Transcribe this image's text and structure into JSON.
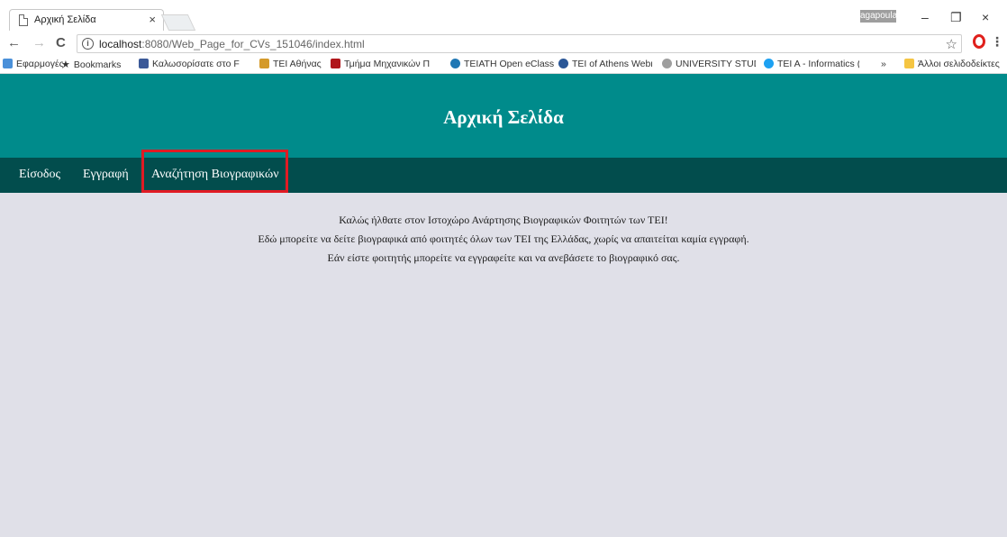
{
  "browser": {
    "tab_title": "Αρχική Σελίδα",
    "tab_close": "×",
    "profile": "agapoula",
    "window_controls": {
      "minimize": "–",
      "restore": "❐",
      "close": "×"
    },
    "url_host": "localhost",
    "url_path": ":8080/Web_Page_for_CVs_151046/index.html",
    "nav_back": "←",
    "nav_forward": "→",
    "nav_reload": "C",
    "info_glyph": "i",
    "star_glyph": "☆",
    "menu_glyph": "⋮",
    "bookmarks": [
      {
        "label": "Εφαρμογές",
        "icon": "apps-icon"
      },
      {
        "label": "Bookmarks",
        "icon": "star-icon"
      },
      {
        "label": "Καλωσορίσατε στο F",
        "icon": "facebook-icon"
      },
      {
        "label": "ΤΕΙ Αθήνας",
        "icon": "tei-icon"
      },
      {
        "label": "Τμήμα Μηχανικών Π",
        "icon": "department-icon"
      },
      {
        "label": "TEIATH Open eClass",
        "icon": "eclass-icon"
      },
      {
        "label": "TEI of Athens Webma",
        "icon": "webmail-icon"
      },
      {
        "label": "UNIVERSITY STUDENT",
        "icon": "university-icon"
      },
      {
        "label": "TEI A - Informatics (©",
        "icon": "twitter-icon"
      },
      {
        "label": "»",
        "icon": ""
      },
      {
        "label": "Άλλοι σελιδοδείκτες",
        "icon": "folder-icon"
      }
    ]
  },
  "page": {
    "title": "Αρχική Σελίδα",
    "nav": {
      "login": "Είσοδος",
      "register": "Εγγραφή",
      "search": "Αναζήτηση Βιογραφικών"
    },
    "welcome_lines": [
      "Καλώς ήλθατε στον Ιστοχώρο Ανάρτησης Βιογραφικών Φοιτητών των ΤΕΙ!",
      "Εδώ μπορείτε να δείτε βιογραφικά από φοιτητές όλων των ΤΕΙ της Ελλάδας, χωρίς να απαιτείται καμία εγγραφή.",
      "Εάν είστε φοιτητής μπορείτε να εγγραφείτε και να ανεβάσετε το βιογραφικό σας."
    ]
  },
  "colors": {
    "header": "#008b8b",
    "navbar": "#024d4d",
    "page_background": "#e0e0e8",
    "highlight": "#e01b24"
  }
}
